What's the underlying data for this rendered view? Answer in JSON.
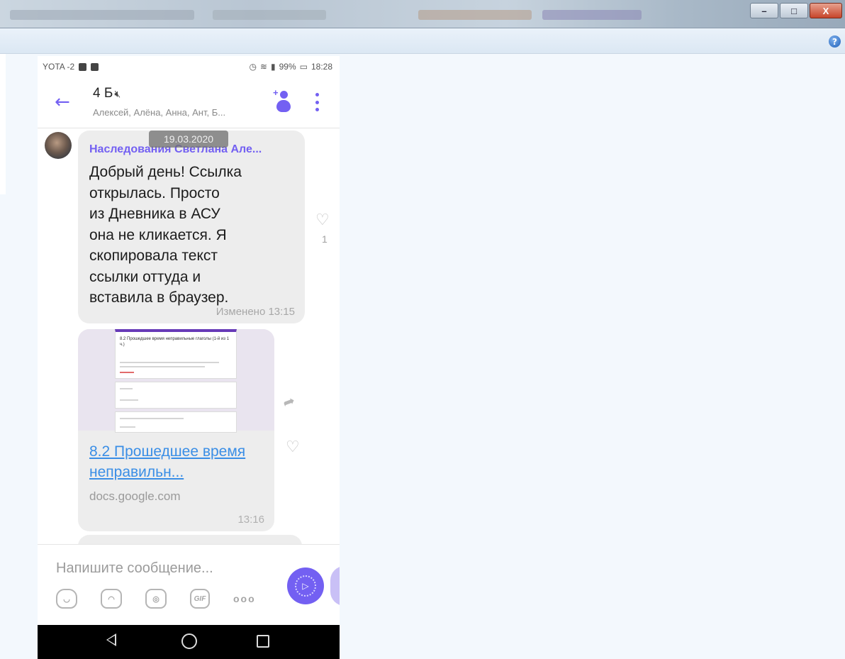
{
  "window": {
    "controls": {
      "minimize": "–",
      "maximize": "□",
      "close": "X"
    },
    "help_icon": "?"
  },
  "phone": {
    "status": {
      "carrier": "YOTA -2",
      "battery": "99%",
      "time": "18:28"
    },
    "header": {
      "title": "4 Б",
      "members": "Алексей, Алёна, Анна, Ант, Б...",
      "icons": [
        "back-arrow-icon",
        "mute-icon",
        "add-member-icon",
        "more-vertical-icon"
      ]
    },
    "messages": [
      {
        "date": "19.03.2020",
        "sender": "Наследования Светлана Але...",
        "text": "Добрый  день! Ссылка\nоткрылась. Просто\nиз Дневника в АСУ\nона не кликается. Я\nскопировала текст\nссылки оттуда и\nвставила в браузер.",
        "status": "Изменено 13:15",
        "likes": "1"
      },
      {
        "preview_title": "8.2 Прошедшее время неправильные глаголы (1-й из 1 ч.)",
        "link_title": "8.2 Прошедшее время неправильн...",
        "domain": "docs.google.com",
        "time": "13:16"
      }
    ],
    "composer": {
      "placeholder": "Напишите сообщение...",
      "gif_label": "GIF",
      "more_label": "ooo"
    }
  },
  "colors": {
    "accent": "#7360f2",
    "link": "#3a8ee6",
    "bubble": "#ededed"
  }
}
